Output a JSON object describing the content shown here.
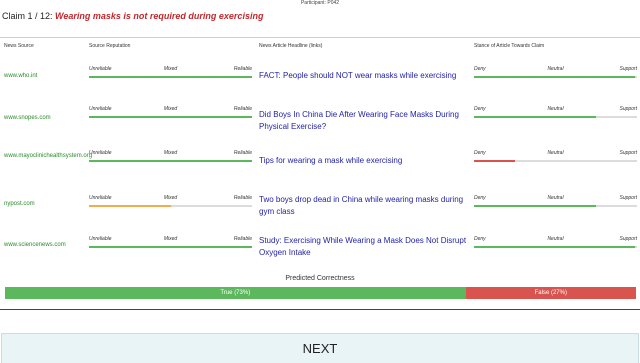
{
  "participant": "Participant: P042",
  "claim": {
    "counter": "Claim 1 / 12:",
    "text": "Wearing masks is not required during exercising"
  },
  "columns": {
    "source": "News Source",
    "reputation": "Source Reputation",
    "headline": "News Article Headline (links)",
    "stance": "Stance of Article Towards Claim"
  },
  "reputation_labels": {
    "left": "Unreliable",
    "mid": "Mixed",
    "right": "Reliable"
  },
  "stance_labels": {
    "left": "Deny",
    "mid": "Neutral",
    "right": "Support"
  },
  "colors": {
    "green": "#5cb85c",
    "orange": "#f0ad4e",
    "red": "#d9534f",
    "link": "#2323a8",
    "claim": "#c0282c"
  },
  "rows": [
    {
      "source": "www.who.int",
      "headline": "FACT: People should NOT wear masks while exercising",
      "reputation": 1.0,
      "reputation_color": "green",
      "stance": 0.99,
      "stance_color": "green"
    },
    {
      "source": "www.snopes.com",
      "headline": "Did Boys In China Die After Wearing Face Masks During Physical Exercise?",
      "reputation": 1.0,
      "reputation_color": "green",
      "stance": 0.75,
      "stance_color": "green"
    },
    {
      "source": "www.mayoclinichealthsystem.org",
      "headline": "Tips for wearing a mask while exercising",
      "reputation": 1.0,
      "reputation_color": "green",
      "stance": 0.25,
      "stance_color": "red"
    },
    {
      "source": "nypost.com",
      "headline": "Two boys drop dead in China while wearing masks during gym class",
      "reputation": 0.5,
      "reputation_color": "orange",
      "stance": 0.75,
      "stance_color": "green"
    },
    {
      "source": "www.sciencenews.com",
      "headline": "Study: Exercising While Wearing a Mask Does Not Disrupt Oxygen Intake",
      "reputation": 1.0,
      "reputation_color": "green",
      "stance": 0.99,
      "stance_color": "green"
    }
  ],
  "prediction": {
    "title": "Predicted Correctness",
    "true_label": "True (73%)",
    "false_label": "False (27%)",
    "true_fraction": 0.73
  },
  "next_label": "NEXT"
}
